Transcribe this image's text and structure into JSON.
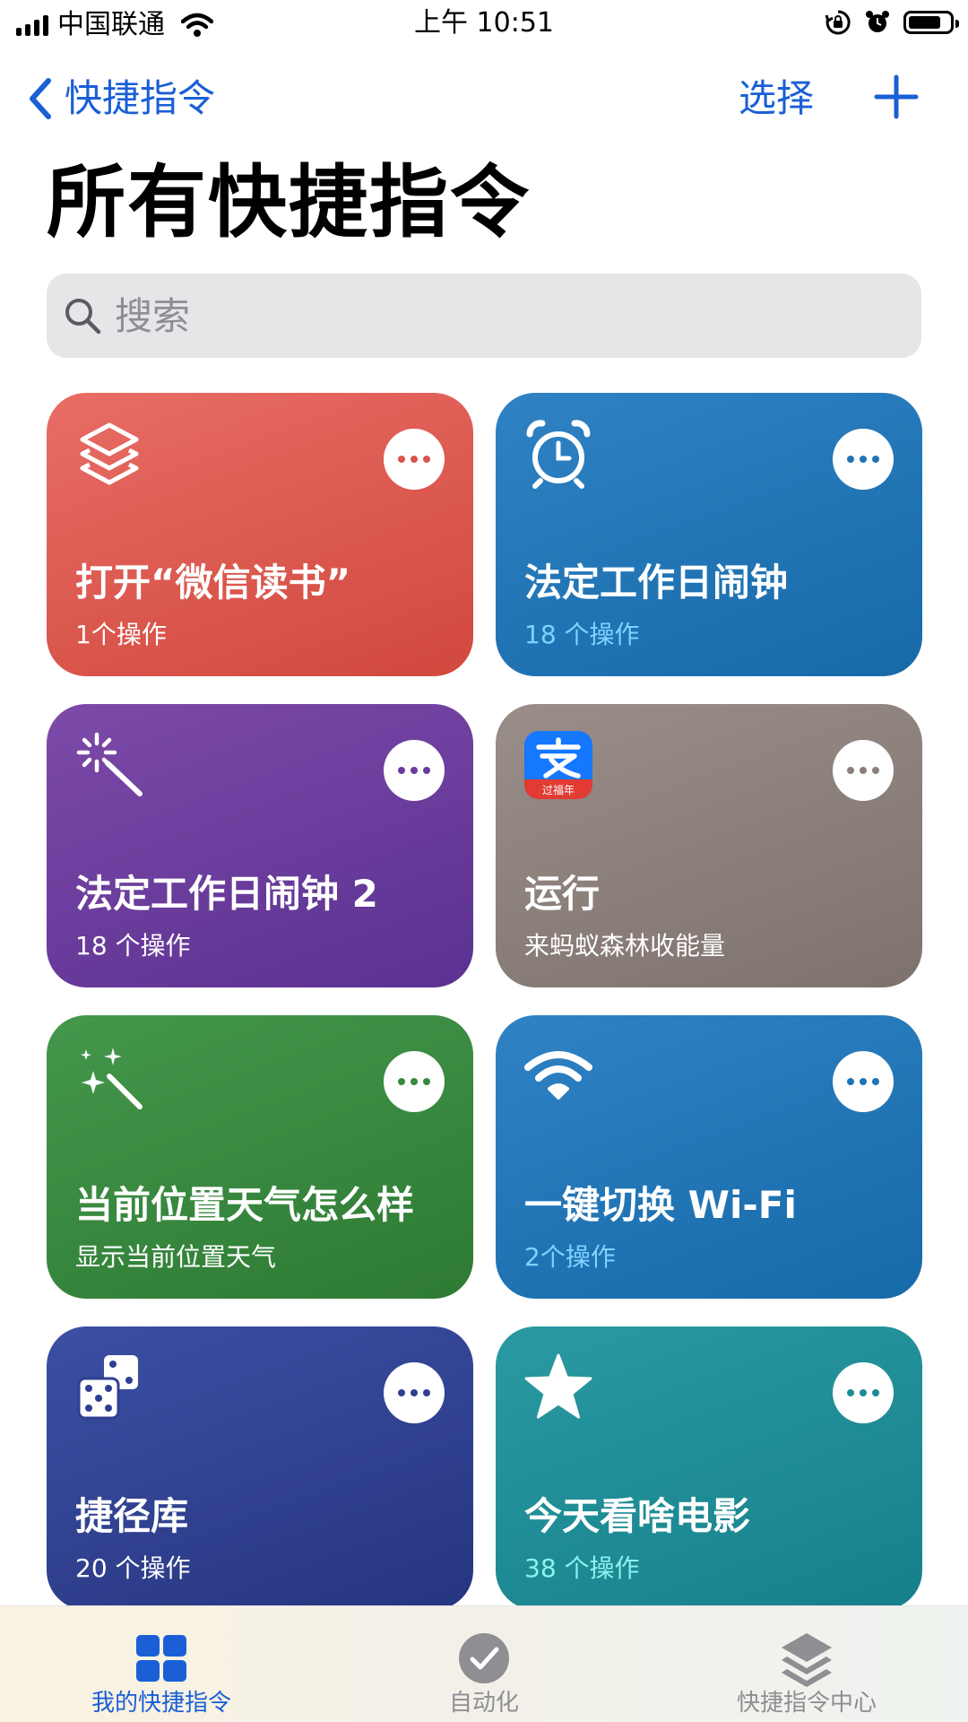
{
  "status_bar": {
    "carrier": "中国联通",
    "time": "上午 10:51",
    "battery_level": 0.8
  },
  "nav": {
    "back_label": "快捷指令",
    "select_label": "选择"
  },
  "page_title": "所有快捷指令",
  "search": {
    "placeholder": "搜索"
  },
  "shortcuts": [
    {
      "title": "打开“微信读书”",
      "subtitle": "1个操作",
      "color": "#d9554b",
      "icon": "layers-icon"
    },
    {
      "title": "法定工作日闹钟",
      "subtitle": "18 个操作",
      "color": "#1f74b6",
      "icon": "alarm-clock-icon"
    },
    {
      "title": "法定工作日闹钟 2",
      "subtitle": "18 个操作",
      "color": "#6a3b9c",
      "icon": "magic-wand-icon"
    },
    {
      "title": "运行",
      "subtitle": "来蚂蚁森林收能量",
      "color": "#8a7f7a",
      "icon": "alipay-app-icon",
      "icon_badge": "过福年"
    },
    {
      "title": "当前位置天气怎么样",
      "subtitle": "显示当前位置天气",
      "color": "#378a3e",
      "icon": "sparkle-wand-icon"
    },
    {
      "title": "一键切换 Wi-Fi",
      "subtitle": "2个操作",
      "color": "#1f74b6",
      "icon": "wifi-icon"
    },
    {
      "title": "捷径库",
      "subtitle": "20 个操作",
      "color": "#2f3f91",
      "icon": "dice-icon"
    },
    {
      "title": "今天看啥电影",
      "subtitle": "38 个操作",
      "color": "#1e8c96",
      "icon": "star-icon"
    }
  ],
  "tabs": [
    {
      "label": "我的快捷指令",
      "icon": "grid-icon",
      "active": true,
      "color": "#1a5fd6"
    },
    {
      "label": "自动化",
      "icon": "checkmark-circle-icon",
      "active": false,
      "color": "#8e8e93"
    },
    {
      "label": "快捷指令中心",
      "icon": "stack-icon",
      "active": false,
      "color": "#8e8e93"
    }
  ]
}
